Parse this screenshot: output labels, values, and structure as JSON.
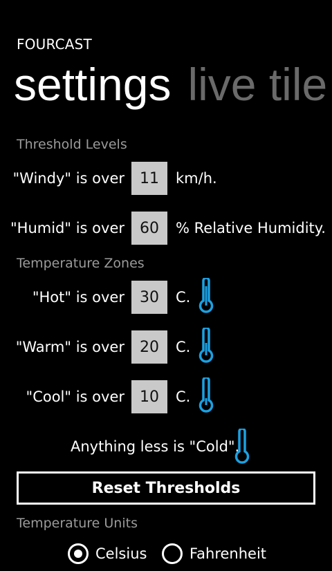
{
  "app": {
    "title": "FOURCAST"
  },
  "pivot": {
    "active": "settings",
    "next": "live tile"
  },
  "threshold_levels": {
    "header": "Threshold Levels",
    "windy": {
      "label": "\"Windy\" is over",
      "value": "11",
      "unit": "km/h."
    },
    "humid": {
      "label": "\"Humid\" is over",
      "value": "60",
      "unit": "% Relative Humidity."
    }
  },
  "temperature_zones": {
    "header": "Temperature Zones",
    "hot": {
      "label": "\"Hot\" is over",
      "value": "30",
      "unit": "C.",
      "icon": "thermometer-icon"
    },
    "warm": {
      "label": "\"Warm\" is over",
      "value": "20",
      "unit": "C.",
      "icon": "thermometer-icon"
    },
    "cool": {
      "label": "\"Cool\" is over",
      "value": "10",
      "unit": "C.",
      "icon": "thermometer-icon"
    },
    "cold_label": "Anything less is \"Cold\"."
  },
  "reset_button": "Reset Thresholds",
  "temperature_units": {
    "header": "Temperature Units",
    "options": [
      "Celsius",
      "Fahrenheit"
    ]
  },
  "colors": {
    "background": "#000000",
    "accent": "#1ba1e2",
    "section_header": "#9b9b9b",
    "input_background": "#c9c9c9"
  }
}
